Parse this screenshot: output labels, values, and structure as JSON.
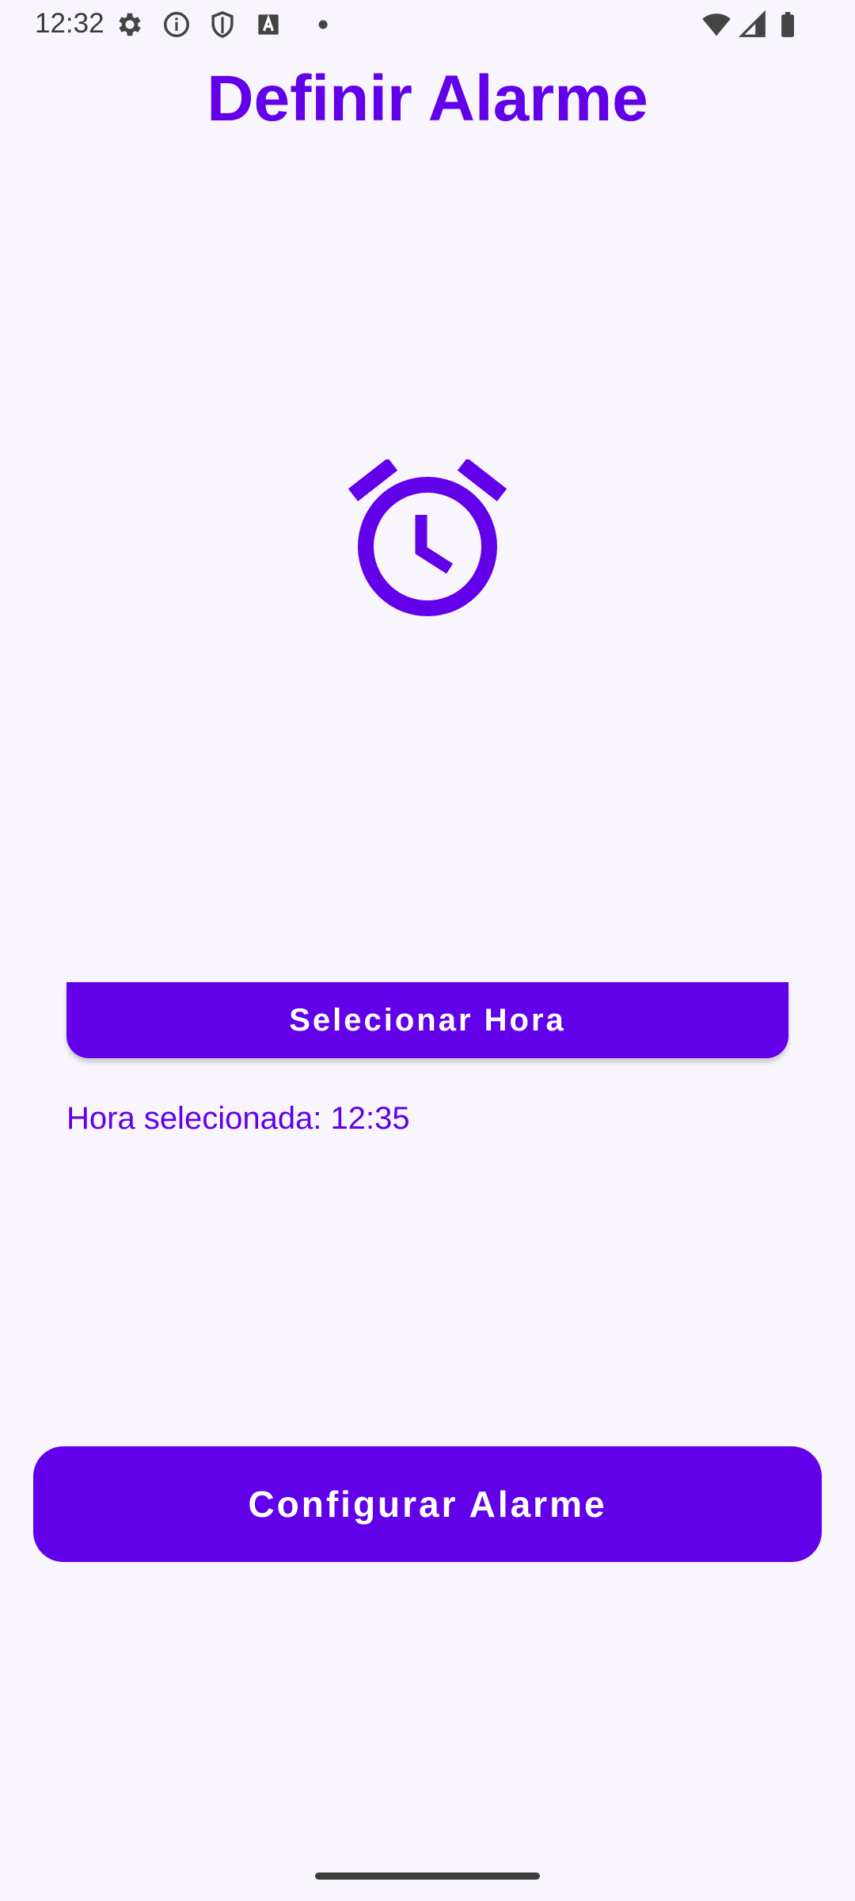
{
  "status_bar": {
    "time": "12:32",
    "left_icons": [
      "gear-icon",
      "info-icon",
      "shield-icon",
      "font-a-icon",
      "dot-icon"
    ],
    "right_icons": [
      "wifi-icon",
      "signal-icon",
      "battery-icon"
    ]
  },
  "header": {
    "title": "Definir Alarme"
  },
  "main": {
    "icon": "alarm-clock-icon",
    "select_time_label": "Selecionar Hora",
    "selected_time_text": "Hora selecionada: 12:35",
    "configure_label": "Configurar Alarme"
  },
  "colors": {
    "accent": "#6200ea",
    "background": "#f8f6fc"
  }
}
